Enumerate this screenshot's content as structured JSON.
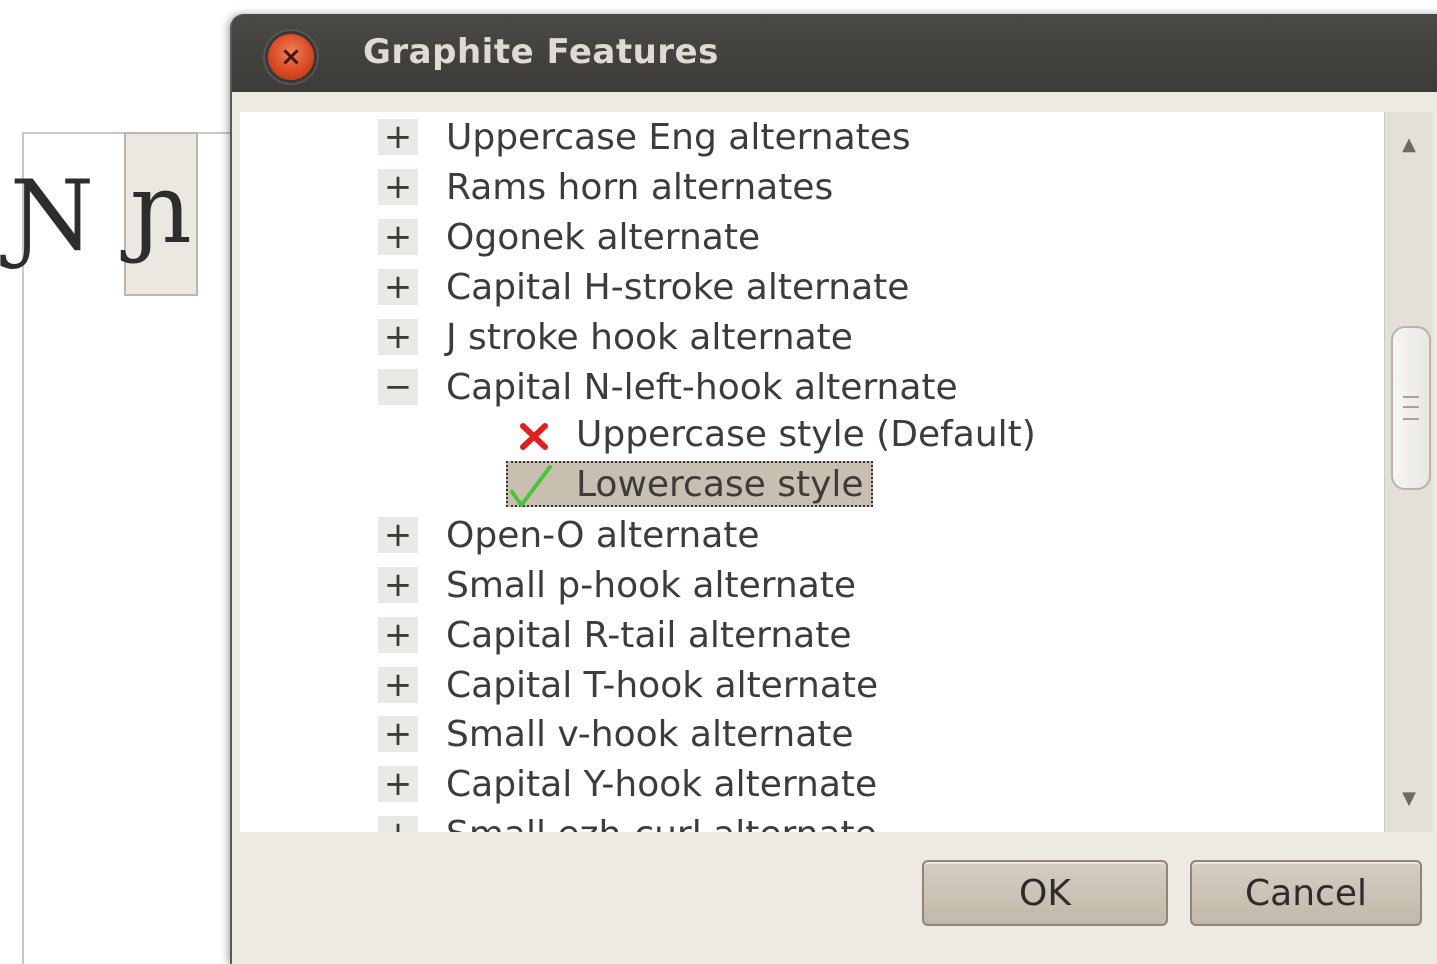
{
  "document": {
    "glyph_1": "Ɲ",
    "glyph_2": "ɲ"
  },
  "dialog": {
    "title": "Graphite Features",
    "close_glyph": "×",
    "buttons": {
      "ok": "OK",
      "cancel": "Cancel"
    }
  },
  "tree": {
    "expand_glyph": "+",
    "collapse_glyph": "−",
    "items": [
      {
        "label": "Uppercase Eng alternates",
        "state": "collapsed"
      },
      {
        "label": "Rams horn alternates",
        "state": "collapsed"
      },
      {
        "label": "Ogonek alternate",
        "state": "collapsed"
      },
      {
        "label": "Capital H-stroke alternate",
        "state": "collapsed"
      },
      {
        "label": "J stroke hook alternate",
        "state": "collapsed"
      },
      {
        "label": "Capital N-left-hook alternate",
        "state": "expanded",
        "children": [
          {
            "label": "Uppercase style (Default)",
            "checked": false,
            "icon": "cross-icon"
          },
          {
            "label": "Lowercase style",
            "checked": true,
            "selected": true,
            "icon": "check-icon"
          }
        ]
      },
      {
        "label": "Open-O alternate",
        "state": "collapsed"
      },
      {
        "label": "Small p-hook alternate",
        "state": "collapsed"
      },
      {
        "label": "Capital R-tail alternate",
        "state": "collapsed"
      },
      {
        "label": "Capital T-hook alternate",
        "state": "collapsed"
      },
      {
        "label": "Small v-hook alternate",
        "state": "collapsed"
      },
      {
        "label": "Capital Y-hook alternate",
        "state": "collapsed"
      },
      {
        "label": "Small ezh-curl alternate",
        "state": "collapsed"
      }
    ]
  },
  "colors": {
    "cross": "#e02020",
    "check": "#44c63a",
    "selection": "#c8bfb0"
  }
}
